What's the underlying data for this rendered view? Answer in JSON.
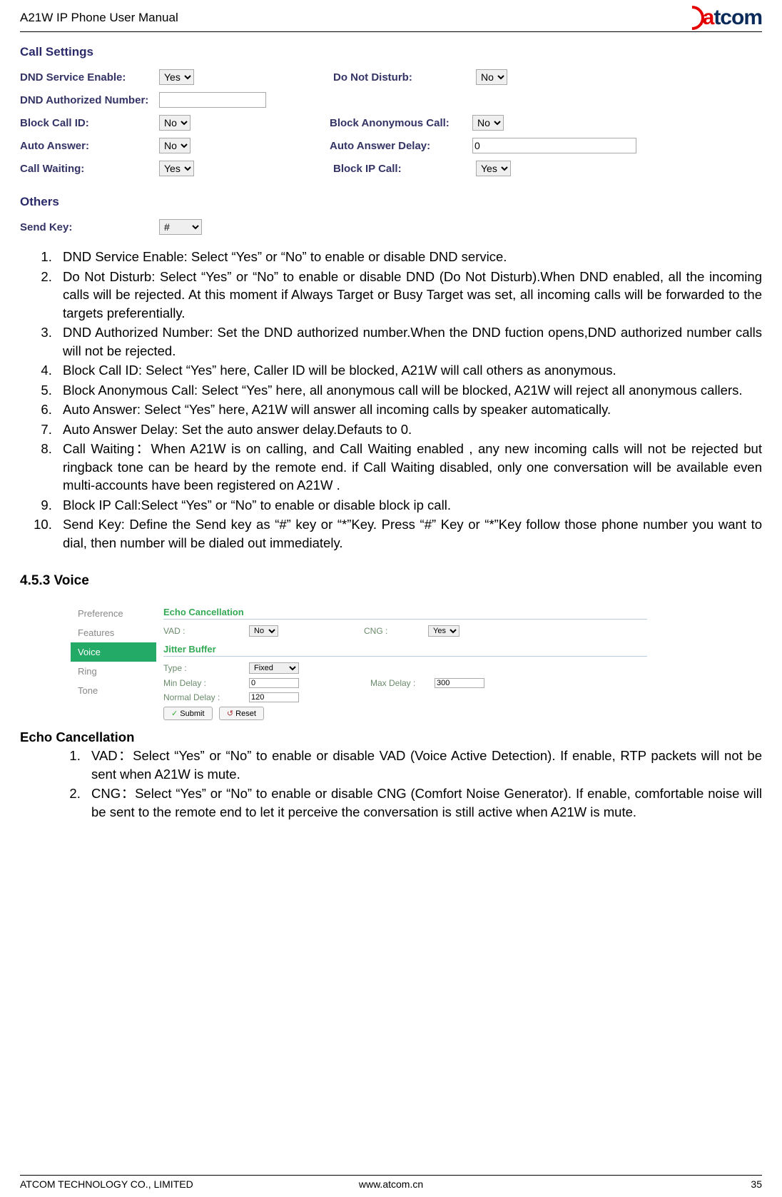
{
  "header": {
    "title": "A21W IP Phone User Manual",
    "logo_a": "a",
    "logo_rest": "tcom"
  },
  "footer": {
    "left": "ATCOM TECHNOLOGY CO., LIMITED",
    "center": "www.atcom.cn",
    "right": "35"
  },
  "callSettings": {
    "title": "Call Settings",
    "othersTitle": "Others",
    "fields": {
      "dndService": {
        "label": "DND Service Enable:",
        "value": "Yes"
      },
      "dnd": {
        "label": "Do Not Disturb:",
        "value": "No"
      },
      "dndAuth": {
        "label": "DND Authorized Number:",
        "value": ""
      },
      "blockCallId": {
        "label": "Block Call ID:",
        "value": "No"
      },
      "blockAnon": {
        "label": "Block Anonymous Call:",
        "value": "No"
      },
      "autoAns": {
        "label": "Auto Answer:",
        "value": "No"
      },
      "autoAnsDelay": {
        "label": "Auto Answer Delay:",
        "value": "0"
      },
      "callWait": {
        "label": "Call Waiting:",
        "value": "Yes"
      },
      "blockIp": {
        "label": "Block IP Call:",
        "value": "Yes"
      },
      "sendKey": {
        "label": "Send Key:",
        "value": "#"
      }
    }
  },
  "list": [
    "DND Service Enable: Select “Yes” or “No” to enable or disable DND service.",
    "Do Not Disturb: Select “Yes” or “No” to enable or disable DND (Do Not Disturb).When DND enabled, all the incoming calls will be rejected. At this moment if Always Target or Busy Target was set, all incoming calls will be forwarded to the targets preferentially.",
    "DND Authorized Number: Set the DND authorized number.When the DND fuction opens,DND authorized number calls will not be rejected.",
    "Block Call ID: Select “Yes” here, Caller ID will be blocked, A21W will call others as anonymous.",
    "Block Anonymous Call: Select “Yes” here, all anonymous call will be blocked, A21W will reject all anonymous callers.",
    "Auto Answer: Select “Yes” here, A21W will answer all incoming calls by speaker automatically.",
    "Auto Answer Delay: Set the auto answer delay.Defauts to 0.",
    "Call Waiting：When A21W is on calling, and Call Waiting enabled , any new incoming calls will not be rejected but ringback tone can be heard by the remote end. if Call Waiting disabled, only one conversation will be available even multi-accounts have been registered on A21W .",
    "Block IP Call:Select “Yes” or “No” to enable or disable block ip call.",
    "Send Key: Define the Send key as “#” key or “*”Key. Press “#” Key or “*”Key follow those phone number you want to dial, then number will be dialed out immediately."
  ],
  "voiceHeading": "4.5.3 Voice",
  "voiceTab": {
    "side": [
      "Preference",
      "Features",
      "Voice",
      "Ring",
      "Tone"
    ],
    "echoTitle": "Echo Cancellation",
    "vad": {
      "label": "VAD :",
      "value": "No"
    },
    "cng": {
      "label": "CNG :",
      "value": "Yes"
    },
    "jitterTitle": "Jitter Buffer",
    "type": {
      "label": "Type :",
      "value": "Fixed"
    },
    "minDelay": {
      "label": "Min Delay :",
      "value": "0"
    },
    "maxDelay": {
      "label": "Max Delay :",
      "value": "300"
    },
    "normalDelay": {
      "label": "Normal Delay :",
      "value": "120"
    },
    "submit": "Submit",
    "reset": "Reset"
  },
  "echoHeading": "Echo Cancellation",
  "echoList": [
    "VAD：Select “Yes” or “No” to enable or disable VAD (Voice Active Detection). If enable, RTP packets will not be sent when A21W is mute.",
    "CNG：Select “Yes” or “No” to enable or disable CNG (Comfort Noise Generator). If enable, comfortable noise will be sent to the remote end to let it perceive the conversation is still active when A21W is mute."
  ]
}
